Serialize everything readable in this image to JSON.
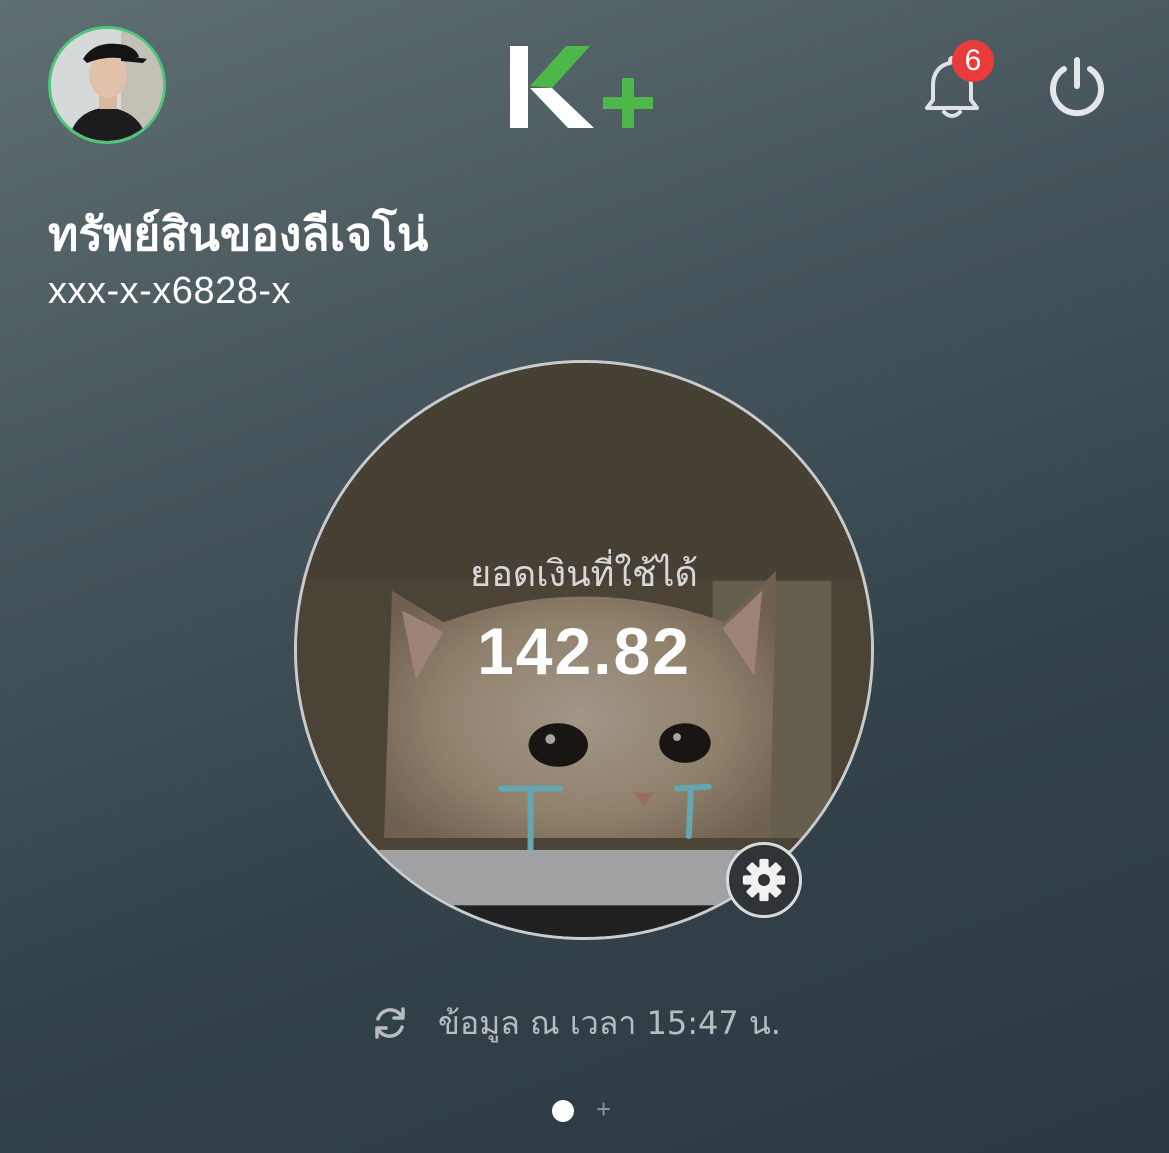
{
  "header": {
    "logo_text": "K+",
    "notification_count": "6"
  },
  "account": {
    "title": "ทรัพย์สินของลีเจโน่",
    "number": "xxx-x-x6828-x"
  },
  "balance": {
    "label": "ยอดเงินที่ใช้ได้",
    "amount": "142.82"
  },
  "footer": {
    "updated_text": "ข้อมูล ณ เวลา 15:47 น.",
    "add_page": "+"
  },
  "icons": {
    "profile": "avatar",
    "notifications": "bell-icon",
    "logout": "power-icon",
    "settings": "gear-icon",
    "refresh": "refresh-icon"
  },
  "colors": {
    "brand_green": "#4db849",
    "badge_red": "#ea3b3b",
    "avatar_ring": "#4fc57c"
  }
}
